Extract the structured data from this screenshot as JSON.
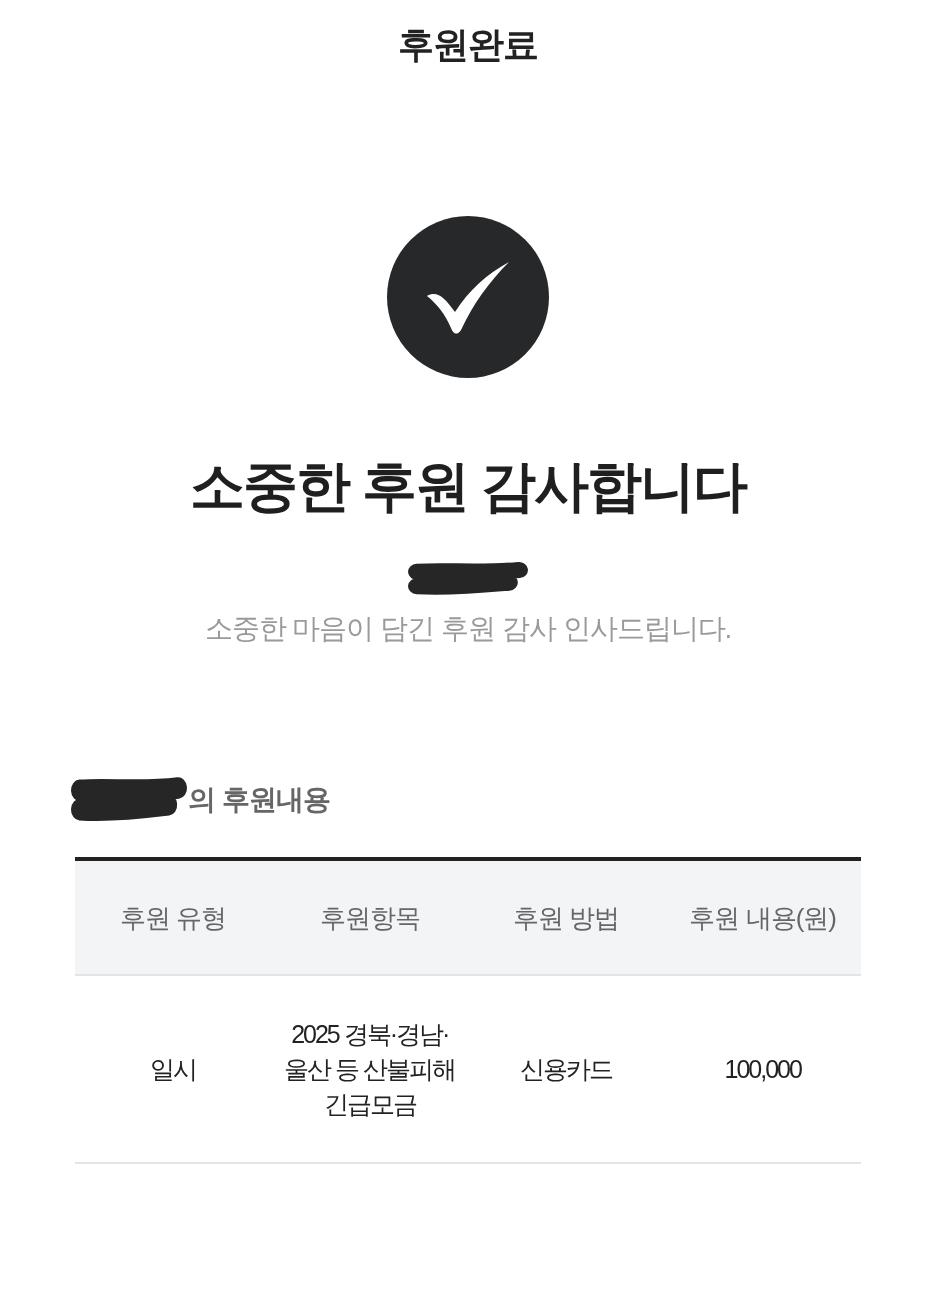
{
  "header": {
    "title": "후원완료"
  },
  "thanks": {
    "heading": "소중한 후원 감사합니다",
    "donor_redacted": true,
    "message": "소중한 마음이 담긴 후원 감사 인사드립니다."
  },
  "summary": {
    "donor_redacted": true,
    "title": "의 후원내용"
  },
  "table": {
    "columns": [
      "후원 유형",
      "후원항목",
      "후원 방법",
      "후원 내용(원)"
    ],
    "rows": [
      [
        "일시",
        "2025 경북·경남·울산 등 산불피해 긴급모금",
        "신용카드",
        "100,000"
      ]
    ]
  }
}
